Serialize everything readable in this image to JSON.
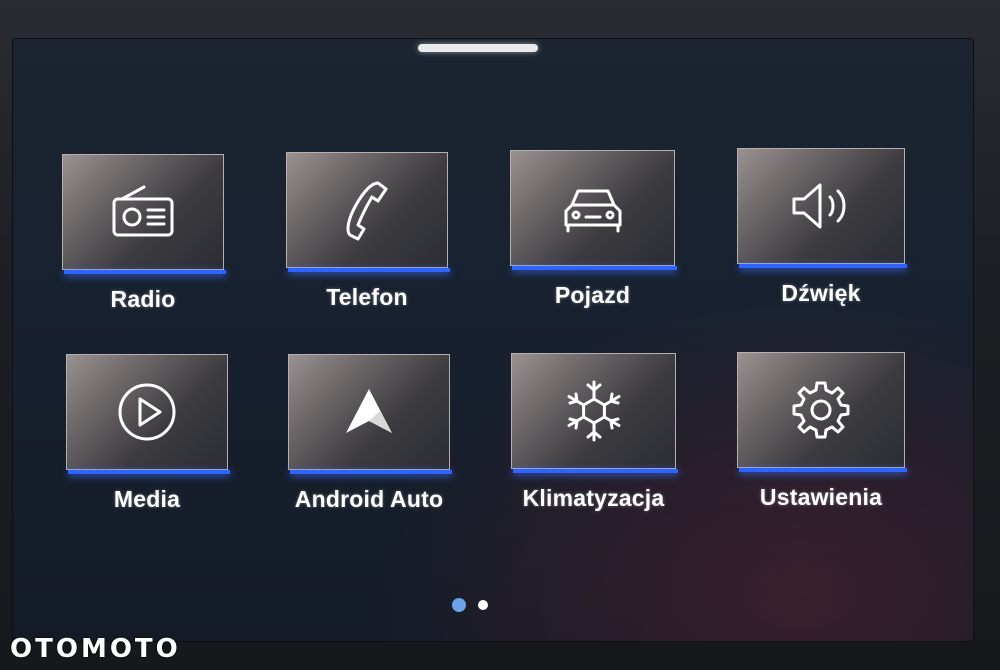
{
  "apps": [
    {
      "label": "Radio",
      "icon": "radio-icon"
    },
    {
      "label": "Telefon",
      "icon": "phone-icon"
    },
    {
      "label": "Pojazd",
      "icon": "car-icon"
    },
    {
      "label": "Dźwięk",
      "icon": "speaker-icon"
    },
    {
      "label": "Media",
      "icon": "play-icon"
    },
    {
      "label": "Android Auto",
      "icon": "android-auto-icon"
    },
    {
      "label": "Klimatyzacja",
      "icon": "snowflake-icon"
    },
    {
      "label": "Ustawienia",
      "icon": "gear-icon"
    }
  ],
  "pagination": {
    "current_page": 1,
    "total_pages": 2
  },
  "colors": {
    "accent_bar": "#2f63ff",
    "active_dot": "#6aa3e8",
    "label_text": "#ffffff"
  },
  "watermark": "OTOMOTO"
}
